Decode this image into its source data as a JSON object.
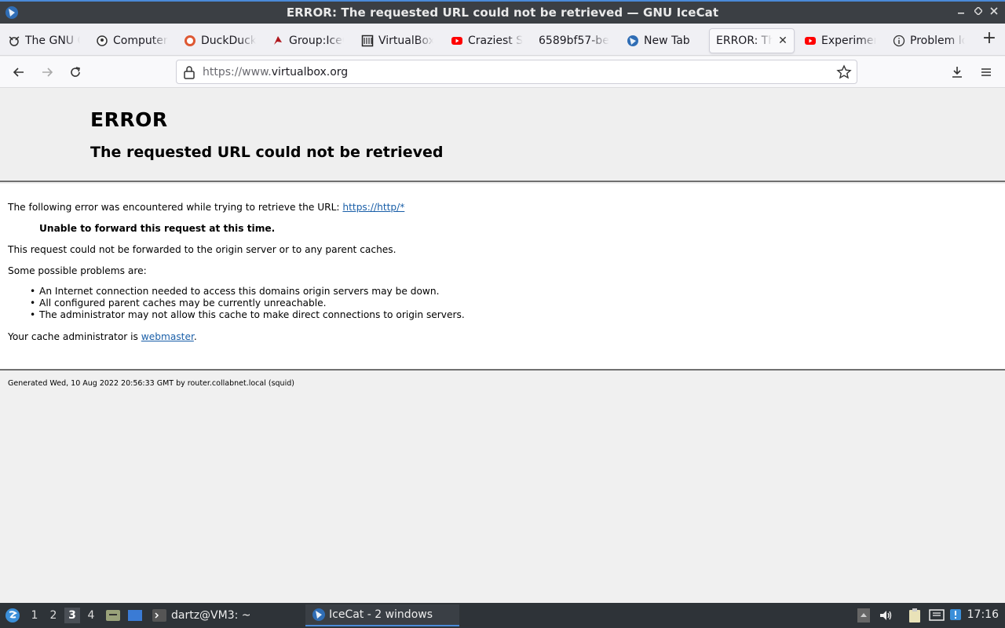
{
  "window": {
    "title": "ERROR: The requested URL could not be retrieved — GNU IceCat",
    "minimize": "▁",
    "maximize": "◆",
    "close": "✕"
  },
  "tabs": [
    {
      "label": "The GNU C",
      "icon": "gnu-icon"
    },
    {
      "label": "Computer",
      "icon": "computer-icon"
    },
    {
      "label": "DuckDuck",
      "icon": "duckduckgo-icon"
    },
    {
      "label": "Group:IceC",
      "icon": "group-icon"
    },
    {
      "label": "VirtualBox",
      "icon": "virtualbox-icon"
    },
    {
      "label": "Craziest S",
      "icon": "youtube-icon"
    },
    {
      "label": "6589bf57-be",
      "icon": ""
    },
    {
      "label": "New Tab",
      "icon": "icecat-icon"
    },
    {
      "label": "ERROR: The",
      "icon": "",
      "active": true
    },
    {
      "label": "Experimen",
      "icon": "youtube-icon"
    },
    {
      "label": "Problem lo",
      "icon": "info-icon"
    }
  ],
  "newtab_label": "+",
  "nav": {
    "url_prefix": "https://www.",
    "url_domain": "virtualbox.org"
  },
  "page": {
    "h1": "ERROR",
    "h2": "The requested URL could not be retrieved",
    "intro": "The following error was encountered while trying to retrieve the URL: ",
    "intro_link": "https://http/*",
    "strong": "Unable to forward this request at this time.",
    "p2": "This request could not be forwarded to the origin server or to any parent caches.",
    "p3": "Some possible problems are:",
    "problems": [
      "An Internet connection needed to access this domains origin servers may be down.",
      "All configured parent caches may be currently unreachable.",
      "The administrator may not allow this cache to make direct connections to origin servers."
    ],
    "admin_prefix": "Your cache administrator is ",
    "admin_link": "webmaster",
    "admin_suffix": ".",
    "footer": "Generated Wed, 10 Aug 2022 20:56:33 GMT by router.collabnet.local (squid)"
  },
  "taskbar": {
    "workspaces": [
      "1",
      "2",
      "3",
      "4"
    ],
    "active_workspace": "3",
    "terminal_task": "dartz@VM3: ~",
    "browser_task": "IceCat - 2 windows",
    "clock": "17:16"
  },
  "colors": {
    "accent": "#4a8ad8",
    "link": "#1a5fa8"
  }
}
